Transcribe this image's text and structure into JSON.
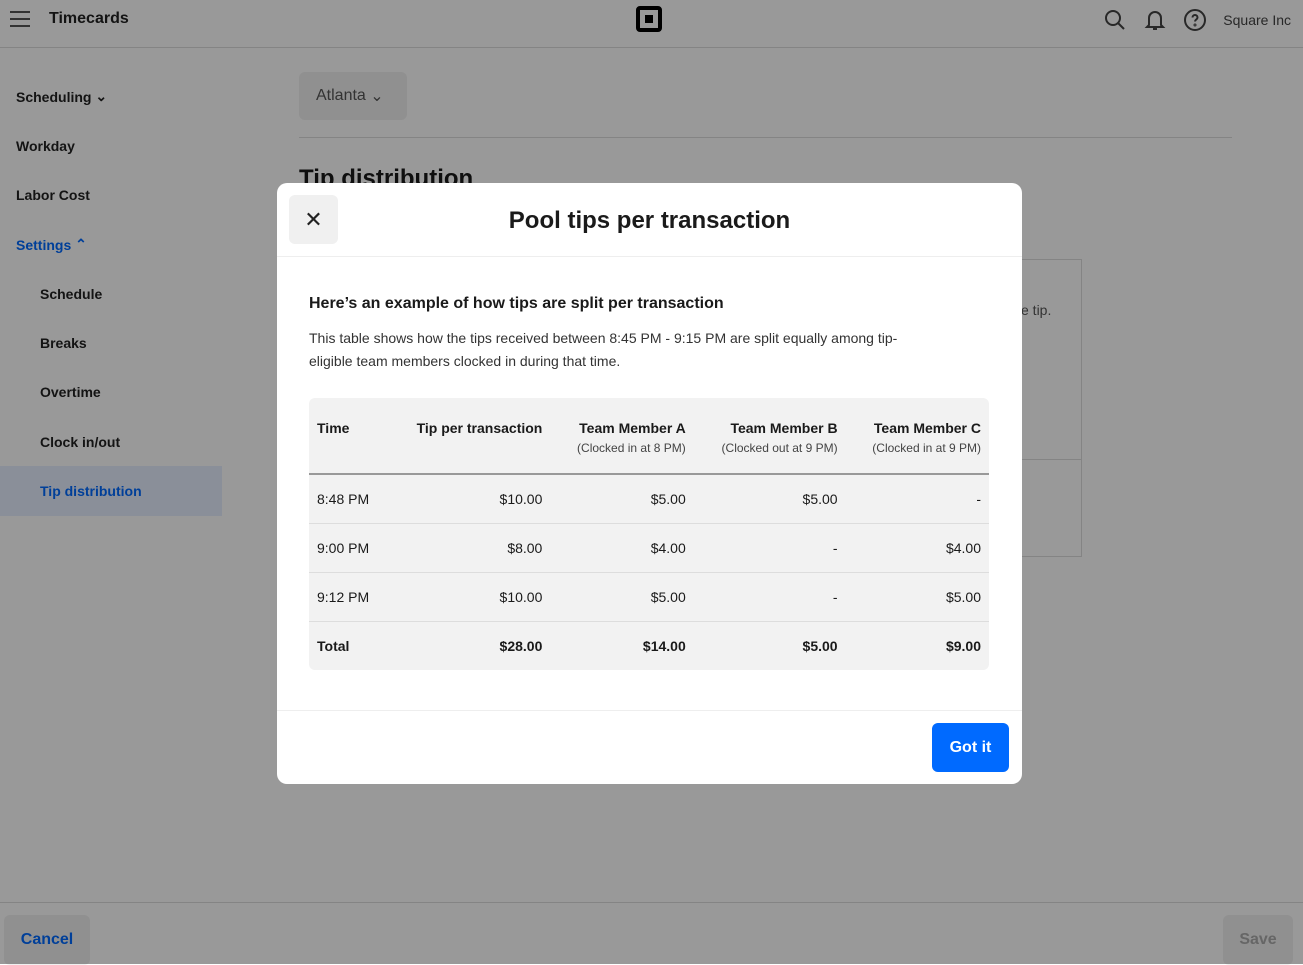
{
  "topbar": {
    "title": "Timecards",
    "account": "Square Inc"
  },
  "sidebar": {
    "items": [
      {
        "label": "Scheduling",
        "chevron": "down"
      },
      {
        "label": "Workday"
      },
      {
        "label": "Labor Cost"
      },
      {
        "label": "Settings",
        "chevron": "up"
      },
      {
        "label": "Schedule"
      },
      {
        "label": "Breaks"
      },
      {
        "label": "Overtime"
      },
      {
        "label": "Clock in/out"
      },
      {
        "label": "Tip distribution",
        "selected": true
      }
    ]
  },
  "main": {
    "location": "Atlanta",
    "title": "Tip distribution",
    "card_text": "e tip."
  },
  "footer": {
    "cancel": "Cancel",
    "save": "Save"
  },
  "modal": {
    "title": "Pool tips per transaction",
    "heading": "Here’s an example of how tips are split per transaction",
    "description": "This table shows how the tips received between 8:45 PM - 9:15 PM are split equally among tip-eligible team members clocked in during that time.",
    "columns": [
      {
        "label": "Time",
        "sub": ""
      },
      {
        "label": "Tip per transaction",
        "sub": ""
      },
      {
        "label": "Team Member A",
        "sub": "(Clocked in at 8 PM)"
      },
      {
        "label": "Team Member B",
        "sub": "(Clocked out at 9 PM)"
      },
      {
        "label": "Team Member C",
        "sub": "(Clocked in at 9 PM)"
      }
    ],
    "rows": [
      [
        "8:48 PM",
        "$10.00",
        "$5.00",
        "$5.00",
        "-"
      ],
      [
        "9:00 PM",
        "$8.00",
        "$4.00",
        "-",
        "$4.00"
      ],
      [
        "9:12 PM",
        "$10.00",
        "$5.00",
        "-",
        "$5.00"
      ],
      [
        "Total",
        "$28.00",
        "$14.00",
        "$5.00",
        "$9.00"
      ]
    ],
    "button": "Got it"
  },
  "colors": {
    "accent": "#006aff",
    "overlay": "rgba(0,0,0,0.4)"
  }
}
